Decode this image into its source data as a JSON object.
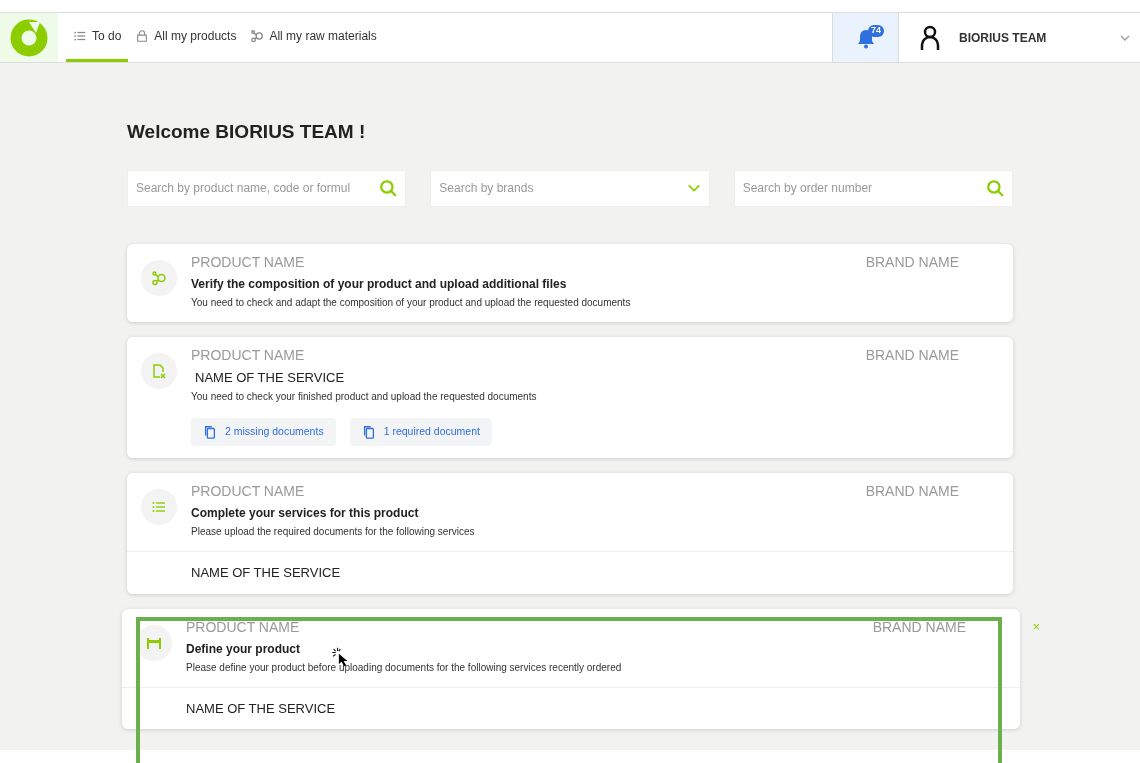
{
  "nav": {
    "tabs": [
      {
        "label": "To do",
        "selected": true
      },
      {
        "label": "All my products",
        "selected": false
      },
      {
        "label": "All my raw materials",
        "selected": false
      }
    ],
    "notifications": {
      "count": "74"
    },
    "user": {
      "name": "BIORIUS TEAM"
    }
  },
  "welcome": "Welcome BIORIUS TEAM !",
  "filters": [
    {
      "kind": "search",
      "placeholder": "Search by product name, code or formul"
    },
    {
      "kind": "select",
      "placeholder": "Search by brands"
    },
    {
      "kind": "search",
      "placeholder": "Search by order number"
    }
  ],
  "cards": [
    {
      "product": "PRODUCT NAME",
      "brand": "BRAND NAME",
      "title": "Verify the composition of your product and upload additional files",
      "title_bold": true,
      "description": "You need to check and adapt the composition of your product and upload the requested documents",
      "highlighted": false
    },
    {
      "product": "PRODUCT NAME",
      "brand": "BRAND NAME",
      "title": "NAME OF THE SERVICE",
      "title_bold": false,
      "description": "You need to check your finished product and upload the requested documents",
      "documents": [
        "2 missing documents",
        "1 required document"
      ],
      "highlighted": false
    },
    {
      "product": "PRODUCT NAME",
      "brand": "BRAND NAME",
      "title": "Complete your services for this product",
      "title_bold": true,
      "description": "Please upload the required documents for the following services",
      "services": [
        "NAME OF THE SERVICE"
      ],
      "highlighted": false
    },
    {
      "product": "PRODUCT NAME",
      "brand": "BRAND NAME",
      "title": "Define your product",
      "title_bold": true,
      "description": "Please define your product before uploading documents for the following services recently ordered",
      "services": [
        "NAME OF THE SERVICE"
      ],
      "highlighted": true,
      "close": "×"
    }
  ]
}
